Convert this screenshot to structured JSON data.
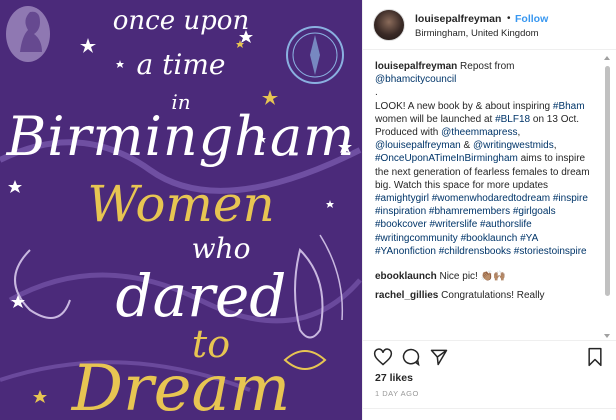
{
  "cover": {
    "line1": "once",
    "line1b": "upon",
    "line2": "a time",
    "line3": "in",
    "line4": "Birmingham",
    "line5": "Women",
    "line6": "who",
    "line7": "dared",
    "line8": "to",
    "line9": "Dream"
  },
  "header": {
    "username": "louisepalfreyman",
    "dot": "•",
    "follow_label": "Follow",
    "location": "Birmingham, United Kingdom"
  },
  "caption": {
    "author": "louisepalfreyman",
    "repost_text": "Repost from",
    "repost_handle": "@bhamcitycouncil",
    "dot": ".",
    "body1": "LOOK! A new book by & about inspiring",
    "tag_bham": "#Bham",
    "body2": "women will be launched at",
    "tag_blf": "#BLF18",
    "body3": "on 13 Oct.",
    "body4": "Produced with",
    "mention_emma": "@theemmapress",
    "mention_louise": "@louisepalfreyman",
    "amp": "&",
    "mention_ww": "@writingwestmids",
    "tag_once": "#OnceUponATimeInBirmingham",
    "body5": "aims to inspire the next generation of fearless females to dream big. Watch this space for more updates",
    "tags": "#amightygirl #womenwhodaredtodream #inspire #inspiration #bhamremembers #girlgoals #bookcover #writerslife #authorslife #writingcommunity #booklaunch #YA #YAnonfiction #childrensbooks #storiestoinspire"
  },
  "comments": [
    {
      "user": "ebooklaunch",
      "text": "Nice pic! 👏🏽🙌🏽"
    },
    {
      "user": "rachel_gillies",
      "text": "Congratulations! Really"
    }
  ],
  "actions": {
    "like_icon": "heart-icon",
    "comment_icon": "comment-icon",
    "share_icon": "share-icon",
    "save_icon": "bookmark-icon"
  },
  "likes": "27 likes",
  "time_ago": "1 DAY AGO",
  "colors": {
    "cover_bg": "#4b2a7a",
    "cover_gold": "#e7c552",
    "link": "#003569",
    "follow": "#3897f0"
  }
}
